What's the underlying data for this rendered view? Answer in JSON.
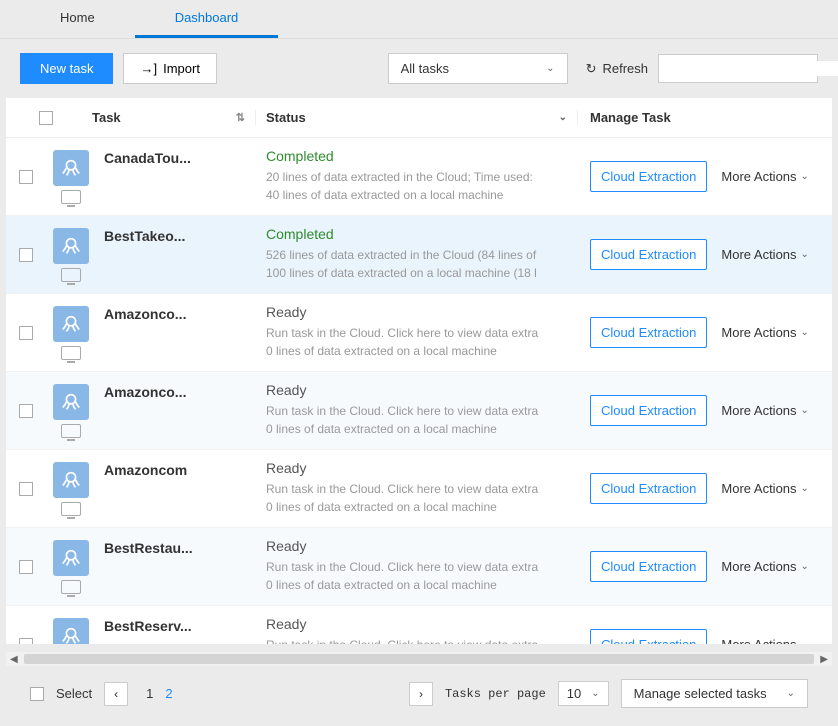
{
  "tabs": {
    "home": "Home",
    "dashboard": "Dashboard"
  },
  "toolbar": {
    "new_task": "New task",
    "import": "Import",
    "task_filter": "All tasks",
    "refresh": "Refresh"
  },
  "headers": {
    "task": "Task",
    "status": "Status",
    "manage": "Manage Task"
  },
  "actions": {
    "cloud_extraction": "Cloud Extraction",
    "more_actions": "More Actions"
  },
  "rows": [
    {
      "name": "CanadaTou...",
      "status_kind": "completed",
      "status_label": "Completed",
      "line1": "20 lines of data extracted in the Cloud; Time used:",
      "line2": "40 lines of data extracted on a local machine"
    },
    {
      "name": "BestTakeo...",
      "status_kind": "completed",
      "status_label": "Completed",
      "line1": "526 lines of data extracted in the Cloud (84 lines of",
      "line2": "100 lines of data extracted on a local machine (18 l"
    },
    {
      "name": "Amazonco...",
      "status_kind": "ready",
      "status_label": "Ready",
      "line1": "Run task in the Cloud. Click here to view data extra",
      "line2": "0 lines of data extracted on a local machine"
    },
    {
      "name": "Amazonco...",
      "status_kind": "ready",
      "status_label": "Ready",
      "line1": "Run task in the Cloud. Click here to view data extra",
      "line2": "0 lines of data extracted on a local machine"
    },
    {
      "name": "Amazoncom",
      "status_kind": "ready",
      "status_label": "Ready",
      "line1": "Run task in the Cloud. Click here to view data extra",
      "line2": "0 lines of data extracted on a local machine"
    },
    {
      "name": "BestRestau...",
      "status_kind": "ready",
      "status_label": "Ready",
      "line1": "Run task in the Cloud. Click here to view data extra",
      "line2": "0 lines of data extracted on a local machine"
    },
    {
      "name": "BestReserv...",
      "status_kind": "ready",
      "status_label": "Ready",
      "line1": "Run task in the Cloud. Click here to view data extra",
      "line2": ""
    }
  ],
  "footer": {
    "select_label": "Select",
    "pages": [
      "1",
      "2"
    ],
    "active_page_index": 1,
    "tasks_per_page_label": "Tasks per page",
    "tasks_per_page_value": "10",
    "manage_selected": "Manage selected tasks"
  }
}
